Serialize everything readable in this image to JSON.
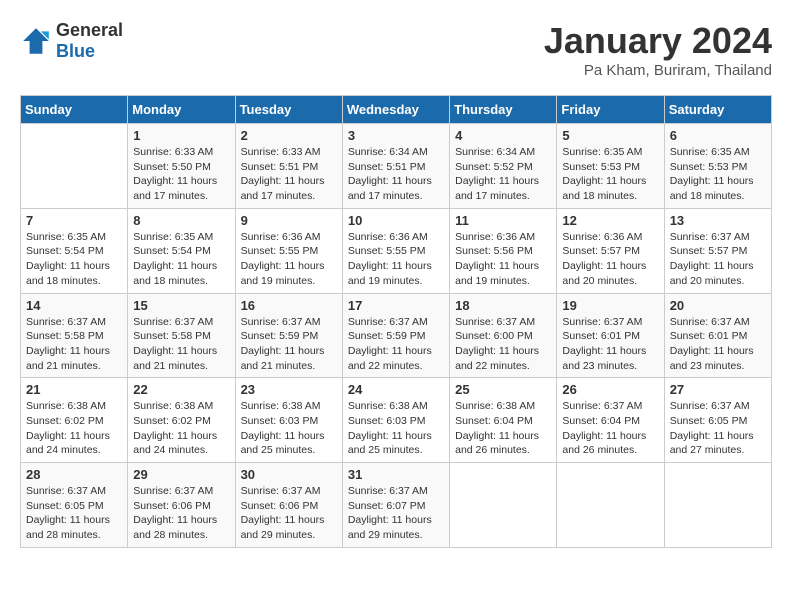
{
  "header": {
    "logo_line1": "General",
    "logo_line2": "Blue",
    "month": "January 2024",
    "location": "Pa Kham, Buriram, Thailand"
  },
  "columns": [
    "Sunday",
    "Monday",
    "Tuesday",
    "Wednesday",
    "Thursday",
    "Friday",
    "Saturday"
  ],
  "weeks": [
    [
      {
        "day": "",
        "sunrise": "",
        "sunset": "",
        "daylight": ""
      },
      {
        "day": "1",
        "sunrise": "Sunrise: 6:33 AM",
        "sunset": "Sunset: 5:50 PM",
        "daylight": "Daylight: 11 hours and 17 minutes."
      },
      {
        "day": "2",
        "sunrise": "Sunrise: 6:33 AM",
        "sunset": "Sunset: 5:51 PM",
        "daylight": "Daylight: 11 hours and 17 minutes."
      },
      {
        "day": "3",
        "sunrise": "Sunrise: 6:34 AM",
        "sunset": "Sunset: 5:51 PM",
        "daylight": "Daylight: 11 hours and 17 minutes."
      },
      {
        "day": "4",
        "sunrise": "Sunrise: 6:34 AM",
        "sunset": "Sunset: 5:52 PM",
        "daylight": "Daylight: 11 hours and 17 minutes."
      },
      {
        "day": "5",
        "sunrise": "Sunrise: 6:35 AM",
        "sunset": "Sunset: 5:53 PM",
        "daylight": "Daylight: 11 hours and 18 minutes."
      },
      {
        "day": "6",
        "sunrise": "Sunrise: 6:35 AM",
        "sunset": "Sunset: 5:53 PM",
        "daylight": "Daylight: 11 hours and 18 minutes."
      }
    ],
    [
      {
        "day": "7",
        "sunrise": "Sunrise: 6:35 AM",
        "sunset": "Sunset: 5:54 PM",
        "daylight": "Daylight: 11 hours and 18 minutes."
      },
      {
        "day": "8",
        "sunrise": "Sunrise: 6:35 AM",
        "sunset": "Sunset: 5:54 PM",
        "daylight": "Daylight: 11 hours and 18 minutes."
      },
      {
        "day": "9",
        "sunrise": "Sunrise: 6:36 AM",
        "sunset": "Sunset: 5:55 PM",
        "daylight": "Daylight: 11 hours and 19 minutes."
      },
      {
        "day": "10",
        "sunrise": "Sunrise: 6:36 AM",
        "sunset": "Sunset: 5:55 PM",
        "daylight": "Daylight: 11 hours and 19 minutes."
      },
      {
        "day": "11",
        "sunrise": "Sunrise: 6:36 AM",
        "sunset": "Sunset: 5:56 PM",
        "daylight": "Daylight: 11 hours and 19 minutes."
      },
      {
        "day": "12",
        "sunrise": "Sunrise: 6:36 AM",
        "sunset": "Sunset: 5:57 PM",
        "daylight": "Daylight: 11 hours and 20 minutes."
      },
      {
        "day": "13",
        "sunrise": "Sunrise: 6:37 AM",
        "sunset": "Sunset: 5:57 PM",
        "daylight": "Daylight: 11 hours and 20 minutes."
      }
    ],
    [
      {
        "day": "14",
        "sunrise": "Sunrise: 6:37 AM",
        "sunset": "Sunset: 5:58 PM",
        "daylight": "Daylight: 11 hours and 21 minutes."
      },
      {
        "day": "15",
        "sunrise": "Sunrise: 6:37 AM",
        "sunset": "Sunset: 5:58 PM",
        "daylight": "Daylight: 11 hours and 21 minutes."
      },
      {
        "day": "16",
        "sunrise": "Sunrise: 6:37 AM",
        "sunset": "Sunset: 5:59 PM",
        "daylight": "Daylight: 11 hours and 21 minutes."
      },
      {
        "day": "17",
        "sunrise": "Sunrise: 6:37 AM",
        "sunset": "Sunset: 5:59 PM",
        "daylight": "Daylight: 11 hours and 22 minutes."
      },
      {
        "day": "18",
        "sunrise": "Sunrise: 6:37 AM",
        "sunset": "Sunset: 6:00 PM",
        "daylight": "Daylight: 11 hours and 22 minutes."
      },
      {
        "day": "19",
        "sunrise": "Sunrise: 6:37 AM",
        "sunset": "Sunset: 6:01 PM",
        "daylight": "Daylight: 11 hours and 23 minutes."
      },
      {
        "day": "20",
        "sunrise": "Sunrise: 6:37 AM",
        "sunset": "Sunset: 6:01 PM",
        "daylight": "Daylight: 11 hours and 23 minutes."
      }
    ],
    [
      {
        "day": "21",
        "sunrise": "Sunrise: 6:38 AM",
        "sunset": "Sunset: 6:02 PM",
        "daylight": "Daylight: 11 hours and 24 minutes."
      },
      {
        "day": "22",
        "sunrise": "Sunrise: 6:38 AM",
        "sunset": "Sunset: 6:02 PM",
        "daylight": "Daylight: 11 hours and 24 minutes."
      },
      {
        "day": "23",
        "sunrise": "Sunrise: 6:38 AM",
        "sunset": "Sunset: 6:03 PM",
        "daylight": "Daylight: 11 hours and 25 minutes."
      },
      {
        "day": "24",
        "sunrise": "Sunrise: 6:38 AM",
        "sunset": "Sunset: 6:03 PM",
        "daylight": "Daylight: 11 hours and 25 minutes."
      },
      {
        "day": "25",
        "sunrise": "Sunrise: 6:38 AM",
        "sunset": "Sunset: 6:04 PM",
        "daylight": "Daylight: 11 hours and 26 minutes."
      },
      {
        "day": "26",
        "sunrise": "Sunrise: 6:37 AM",
        "sunset": "Sunset: 6:04 PM",
        "daylight": "Daylight: 11 hours and 26 minutes."
      },
      {
        "day": "27",
        "sunrise": "Sunrise: 6:37 AM",
        "sunset": "Sunset: 6:05 PM",
        "daylight": "Daylight: 11 hours and 27 minutes."
      }
    ],
    [
      {
        "day": "28",
        "sunrise": "Sunrise: 6:37 AM",
        "sunset": "Sunset: 6:05 PM",
        "daylight": "Daylight: 11 hours and 28 minutes."
      },
      {
        "day": "29",
        "sunrise": "Sunrise: 6:37 AM",
        "sunset": "Sunset: 6:06 PM",
        "daylight": "Daylight: 11 hours and 28 minutes."
      },
      {
        "day": "30",
        "sunrise": "Sunrise: 6:37 AM",
        "sunset": "Sunset: 6:06 PM",
        "daylight": "Daylight: 11 hours and 29 minutes."
      },
      {
        "day": "31",
        "sunrise": "Sunrise: 6:37 AM",
        "sunset": "Sunset: 6:07 PM",
        "daylight": "Daylight: 11 hours and 29 minutes."
      },
      {
        "day": "",
        "sunrise": "",
        "sunset": "",
        "daylight": ""
      },
      {
        "day": "",
        "sunrise": "",
        "sunset": "",
        "daylight": ""
      },
      {
        "day": "",
        "sunrise": "",
        "sunset": "",
        "daylight": ""
      }
    ]
  ]
}
